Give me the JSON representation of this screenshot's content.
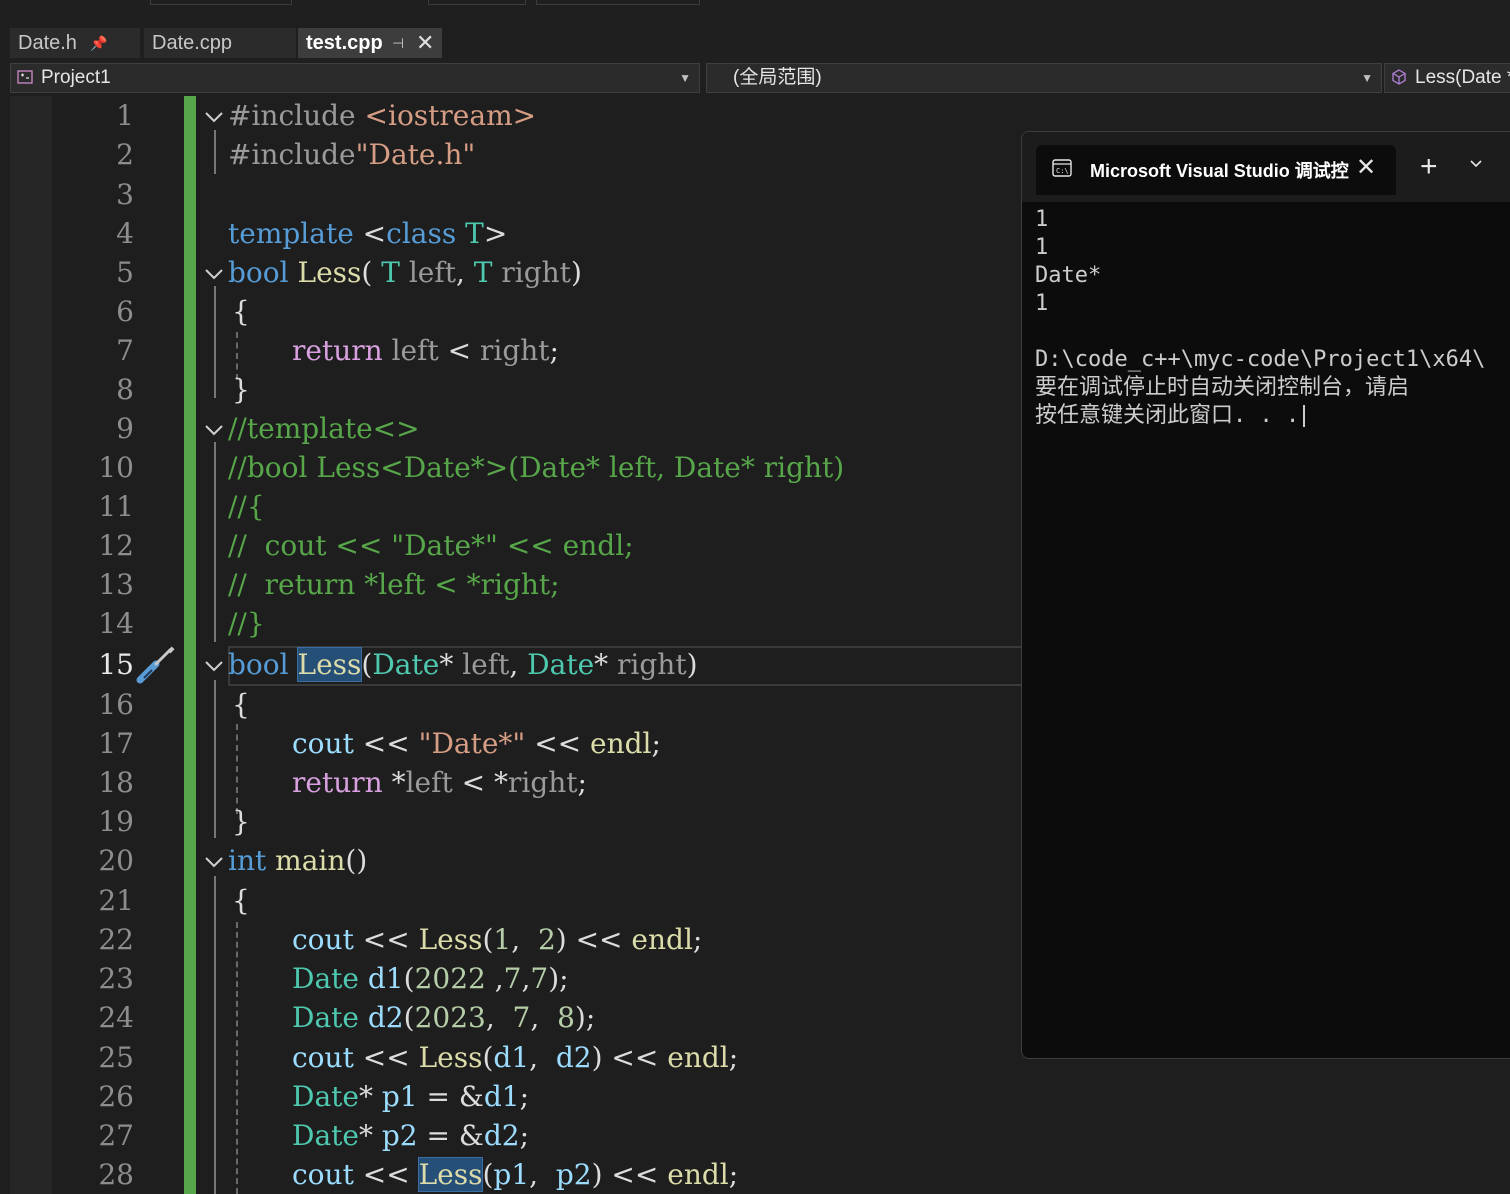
{
  "tabs": [
    {
      "label": "Date.h",
      "pin": "📌"
    },
    {
      "label": "Date.cpp"
    },
    {
      "label": "test.cpp",
      "pin": "⊣",
      "close": "✕"
    }
  ],
  "nav": {
    "project": "Project1",
    "scope": "(全局范围)",
    "member": "Less(Date *"
  },
  "line_numbers": [
    "1",
    "2",
    "3",
    "4",
    "5",
    "6",
    "7",
    "8",
    "9",
    "10",
    "11",
    "12",
    "13",
    "14",
    "15",
    "16",
    "17",
    "18",
    "19",
    "20",
    "21",
    "22",
    "23",
    "24",
    "25",
    "26",
    "27",
    "28"
  ],
  "current_line": "15",
  "code": {
    "l1": [
      "#include",
      " ",
      "<iostream>"
    ],
    "l2": [
      "#include",
      "\"Date.h\""
    ],
    "l4": [
      "template",
      " <",
      "class",
      " ",
      "T",
      ">"
    ],
    "l5": [
      "bool",
      " ",
      "Less",
      "( ",
      "T",
      " ",
      "left",
      ", ",
      "T",
      " ",
      "right",
      ")"
    ],
    "l6": "{",
    "l7": [
      "return",
      " ",
      "left",
      " < ",
      "right",
      ";"
    ],
    "l8": "}",
    "l9": "//template<>",
    "l10": "//bool Less<Date*>(Date* left, Date* right)",
    "l11": "//{",
    "l12": "//  cout << \"Date*\" << endl;",
    "l13": "//  return *left < *right;",
    "l14": "//}",
    "l15": [
      "bool",
      " ",
      "Less",
      "(",
      "Date",
      "* ",
      "left",
      ", ",
      "Date",
      "* ",
      "right",
      ")"
    ],
    "l16": "{",
    "l17": [
      "cout",
      " << ",
      "\"Date*\"",
      " << ",
      "endl",
      ";"
    ],
    "l18": [
      "return",
      " *",
      "left",
      " < *",
      "right",
      ";"
    ],
    "l19": "}",
    "l20": [
      "int",
      " ",
      "main",
      "()"
    ],
    "l21": "{",
    "l22": [
      "cout",
      " << ",
      "Less",
      "(",
      "1",
      ",  ",
      "2",
      ") << ",
      "endl",
      ";"
    ],
    "l23": [
      "Date",
      " ",
      "d1",
      "(",
      "2022",
      " ,",
      "7",
      ",",
      "7",
      ");"
    ],
    "l24": [
      "Date",
      " ",
      "d2",
      "(",
      "2023",
      ",  ",
      "7",
      ",  ",
      "8",
      ");"
    ],
    "l25": [
      "cout",
      " << ",
      "Less",
      "(",
      "d1",
      ",  ",
      "d2",
      ") << ",
      "endl",
      ";"
    ],
    "l26": [
      "Date",
      "* ",
      "p1",
      " = &",
      "d1",
      ";"
    ],
    "l27": [
      "Date",
      "* ",
      "p2",
      " = &",
      "d2",
      ";"
    ],
    "l28": [
      "cout",
      " << ",
      "Less",
      "(",
      "p1",
      ",  ",
      "p2",
      ") << ",
      "endl",
      ";"
    ]
  },
  "console": {
    "title": "Microsoft Visual Studio 调试控",
    "close": "✕",
    "plus": "+",
    "lines": [
      "1",
      "1",
      "Date*",
      "1",
      "",
      "D:\\code_c++\\myc-code\\Project1\\x64\\",
      "要在调试停止时自动关闭控制台，请启",
      "按任意键关闭此窗口. . ."
    ]
  },
  "colors": {
    "background": "#1e1e1e",
    "keyword": "#569cd6",
    "type": "#4ec9b0",
    "function": "#dcdcaa",
    "string": "#d69d85",
    "comment": "#57a64a",
    "control": "#d8a0df",
    "number": "#b5cea8",
    "variable": "#9cdcfe",
    "change_bar": "#57a64a",
    "highlight": "#264f78"
  },
  "icons": [
    "pin-icon",
    "close-icon",
    "project-icon",
    "dropdown-icon",
    "member-cube-icon",
    "fold-chevron-icon",
    "quick-action-screwdriver-icon",
    "console-icon",
    "new-tab-icon"
  ]
}
